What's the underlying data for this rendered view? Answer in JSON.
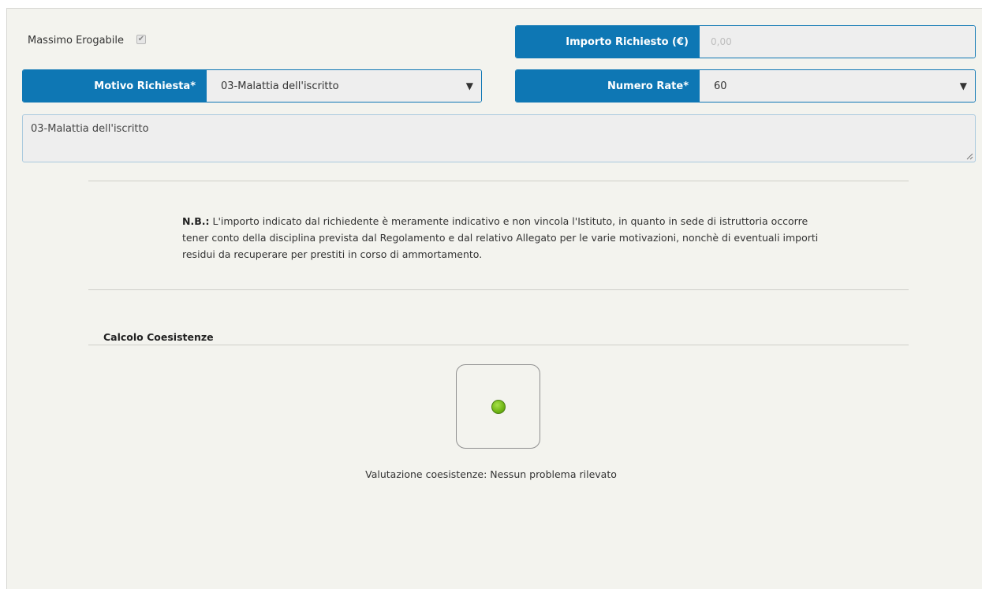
{
  "form": {
    "massimo_erogabile_label": "Massimo Erogabile",
    "massimo_erogabile_checked": true,
    "importo_label": "Importo Richiesto (€)",
    "importo_value": "0,00",
    "motivo_label": "Motivo Richiesta*",
    "motivo_value": "03-Malattia dell'iscritto",
    "numero_rate_label": "Numero Rate*",
    "numero_rate_value": "60",
    "description_value": "03-Malattia dell'iscritto"
  },
  "note": {
    "prefix": "N.B.:",
    "text": " L'importo indicato dal richiedente è meramente indicativo e non vincola l'Istituto, in quanto in sede di istruttoria occorre tener conto della disciplina prevista dal Regolamento e dal relativo Allegato per le varie motivazioni, nonchè di eventuali importi residui da recuperare per prestiti in corso di ammortamento."
  },
  "coesistenze": {
    "title": "Calcolo Coesistenze",
    "status_color": "#6fb514",
    "status_text": "Valutazione coesistenze: Nessun problema rilevato"
  },
  "icons": {
    "checkbox": "checkmark-icon",
    "dropdown": "triangle-down-icon",
    "resize": "resize-grip-icon",
    "status": "green-light-icon"
  }
}
